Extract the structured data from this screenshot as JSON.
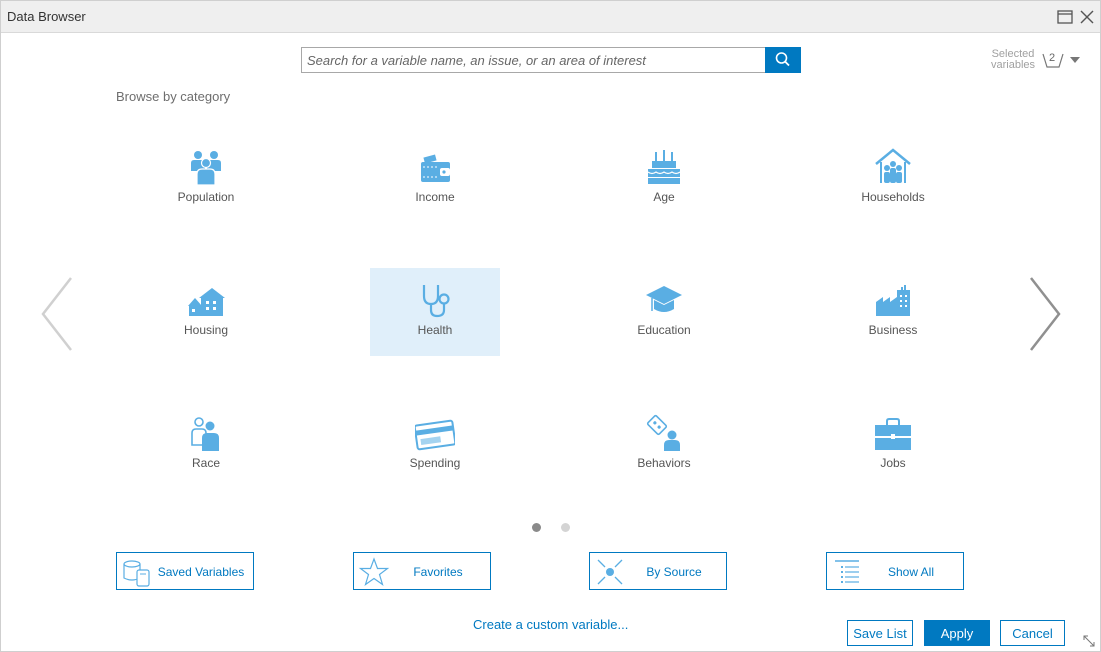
{
  "window": {
    "title": "Data Browser"
  },
  "search": {
    "placeholder": "Search for a variable name, an issue, or an area of interest"
  },
  "selected_variables": {
    "label": "Selected variables",
    "count": "2"
  },
  "browse_label": "Browse by category",
  "categories": [
    {
      "label": "Population",
      "icon": "population-icon"
    },
    {
      "label": "Income",
      "icon": "income-icon"
    },
    {
      "label": "Age",
      "icon": "age-icon"
    },
    {
      "label": "Households",
      "icon": "households-icon"
    },
    {
      "label": "Housing",
      "icon": "housing-icon"
    },
    {
      "label": "Health",
      "icon": "health-icon"
    },
    {
      "label": "Education",
      "icon": "education-icon"
    },
    {
      "label": "Business",
      "icon": "business-icon"
    },
    {
      "label": "Race",
      "icon": "race-icon"
    },
    {
      "label": "Spending",
      "icon": "spending-icon"
    },
    {
      "label": "Behaviors",
      "icon": "behaviors-icon"
    },
    {
      "label": "Jobs",
      "icon": "jobs-icon"
    }
  ],
  "pagination": {
    "pages": 2,
    "current": 1
  },
  "browse_buttons": {
    "saved": "Saved Variables",
    "favorites": "Favorites",
    "by_source": "By Source",
    "show_all": "Show All"
  },
  "custom_variable_link": "Create a custom variable...",
  "footer": {
    "save_list": "Save List",
    "apply": "Apply",
    "cancel": "Cancel"
  },
  "colors": {
    "accent": "#0079c1",
    "icon": "#5aaee3",
    "highlight": "#e0effa"
  }
}
